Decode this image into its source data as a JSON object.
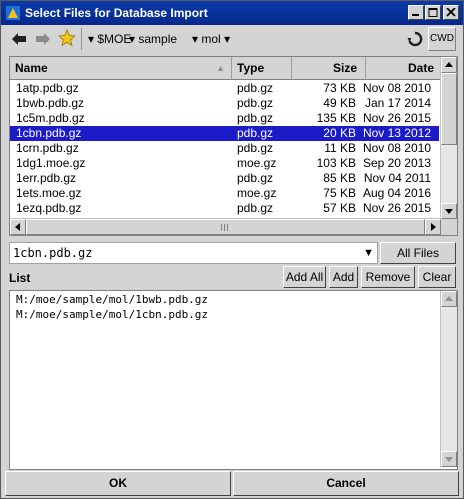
{
  "window": {
    "title": "Select Files for Database Import"
  },
  "toolbar": {
    "path": [
      "$MOE",
      "sample",
      "mol"
    ],
    "cwd_label": "CWD"
  },
  "file_list": {
    "columns": [
      "Name",
      "Type",
      "Size",
      "Date"
    ],
    "rows": [
      {
        "name": "1atp.pdb.gz",
        "type": "pdb.gz",
        "size": "73 KB",
        "date": "Nov 08 2010"
      },
      {
        "name": "1bwb.pdb.gz",
        "type": "pdb.gz",
        "size": "49 KB",
        "date": "Jan 17 2014"
      },
      {
        "name": "1c5m.pdb.gz",
        "type": "pdb.gz",
        "size": "135 KB",
        "date": "Nov 26 2015"
      },
      {
        "name": "1cbn.pdb.gz",
        "type": "pdb.gz",
        "size": "20 KB",
        "date": "Nov 13 2012",
        "selected": true
      },
      {
        "name": "1crn.pdb.gz",
        "type": "pdb.gz",
        "size": "11 KB",
        "date": "Nov 08 2010"
      },
      {
        "name": "1dg1.moe.gz",
        "type": "moe.gz",
        "size": "103 KB",
        "date": "Sep 20 2013"
      },
      {
        "name": "1err.pdb.gz",
        "type": "pdb.gz",
        "size": "85 KB",
        "date": "Nov 04 2011"
      },
      {
        "name": "1ets.moe.gz",
        "type": "moe.gz",
        "size": "75 KB",
        "date": "Aug 04 2016"
      },
      {
        "name": "1ezq.pdb.gz",
        "type": "pdb.gz",
        "size": "57 KB",
        "date": "Nov 26 2015"
      }
    ],
    "selected_color": "#1b1bc8"
  },
  "filename_field": {
    "value": "1cbn.pdb.gz"
  },
  "filter_button": "All Files",
  "list_section": {
    "label": "List",
    "buttons": {
      "add_all": "Add All",
      "add": "Add",
      "remove": "Remove",
      "clear": "Clear"
    },
    "items": [
      "M:/moe/sample/mol/1bwb.pdb.gz",
      "M:/moe/sample/mol/1cbn.pdb.gz"
    ]
  },
  "footer": {
    "ok": "OK",
    "cancel": "Cancel"
  },
  "icons": [
    "app-icon",
    "minimize-icon",
    "maximize-icon",
    "close-icon",
    "back-arrow-icon",
    "forward-arrow-icon",
    "star-icon",
    "dropdown-icon",
    "refresh-icon",
    "sort-icon"
  ]
}
